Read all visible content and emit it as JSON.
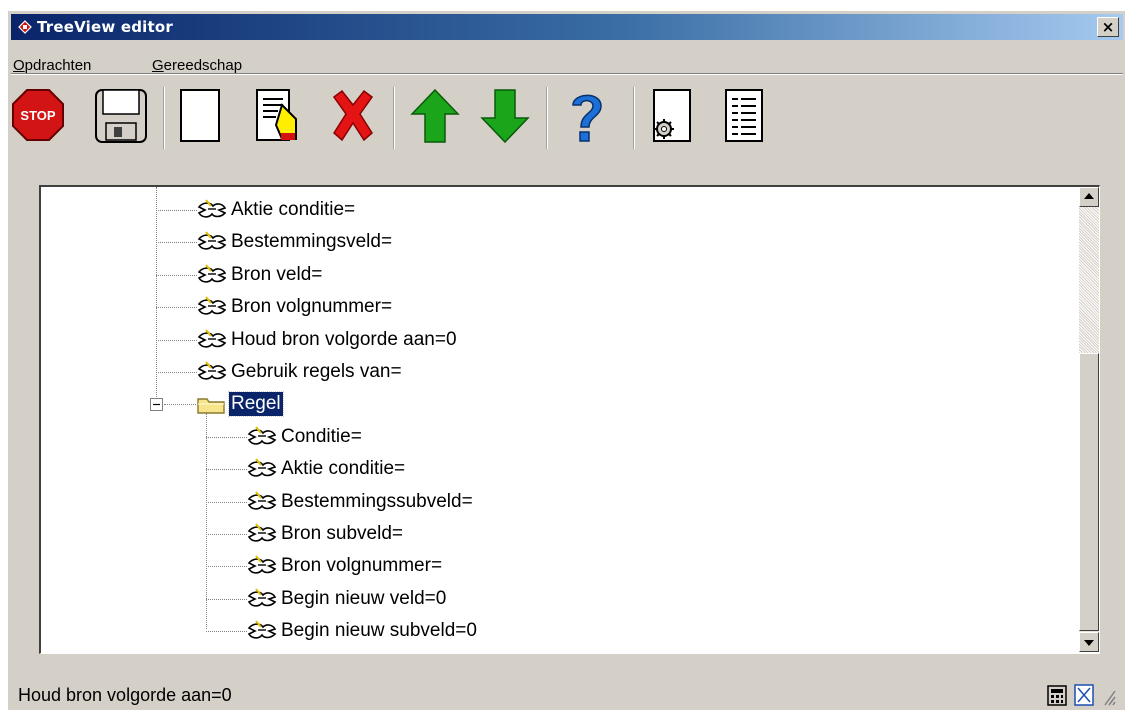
{
  "window": {
    "title": "TreeView editor",
    "close_label": "×"
  },
  "menu": {
    "items": [
      "Opdrachten",
      "Gereedschap"
    ]
  },
  "toolbar": {
    "stop_label": "STOP",
    "buttons": [
      "stop",
      "save",
      "new",
      "edit",
      "delete",
      "move-up",
      "move-down",
      "help",
      "settings",
      "list"
    ]
  },
  "tree": {
    "items": [
      {
        "label": "Aktie conditie=",
        "level": 1,
        "icon": "property-icon"
      },
      {
        "label": "Bestemmingsveld=",
        "level": 1,
        "icon": "property-icon"
      },
      {
        "label": "Bron veld=",
        "level": 1,
        "icon": "property-icon"
      },
      {
        "label": "Bron volgnummer=",
        "level": 1,
        "icon": "property-icon"
      },
      {
        "label": "Houd bron volgorde aan=0",
        "level": 1,
        "icon": "property-icon"
      },
      {
        "label": "Gebruik regels van=",
        "level": 1,
        "icon": "property-icon"
      },
      {
        "label": "Regel",
        "level": 0,
        "icon": "folder-icon",
        "selected": true,
        "expanded": true
      },
      {
        "label": "Conditie=",
        "level": 2,
        "icon": "property-icon"
      },
      {
        "label": "Aktie conditie=",
        "level": 2,
        "icon": "property-icon"
      },
      {
        "label": "Bestemmingssubveld=",
        "level": 2,
        "icon": "property-icon"
      },
      {
        "label": "Bron subveld=",
        "level": 2,
        "icon": "property-icon"
      },
      {
        "label": "Bron volgnummer=",
        "level": 2,
        "icon": "property-icon"
      },
      {
        "label": "Begin nieuw veld=0",
        "level": 2,
        "icon": "property-icon"
      },
      {
        "label": "Begin nieuw subveld=0",
        "level": 2,
        "icon": "property-icon"
      }
    ]
  },
  "status": {
    "text": "Houd bron volgorde aan=0"
  },
  "colors": {
    "title_gradient_start": "#0a246a",
    "title_gradient_end": "#a6caf0",
    "selection": "#0a246a",
    "chrome": "#d4d0c8"
  }
}
